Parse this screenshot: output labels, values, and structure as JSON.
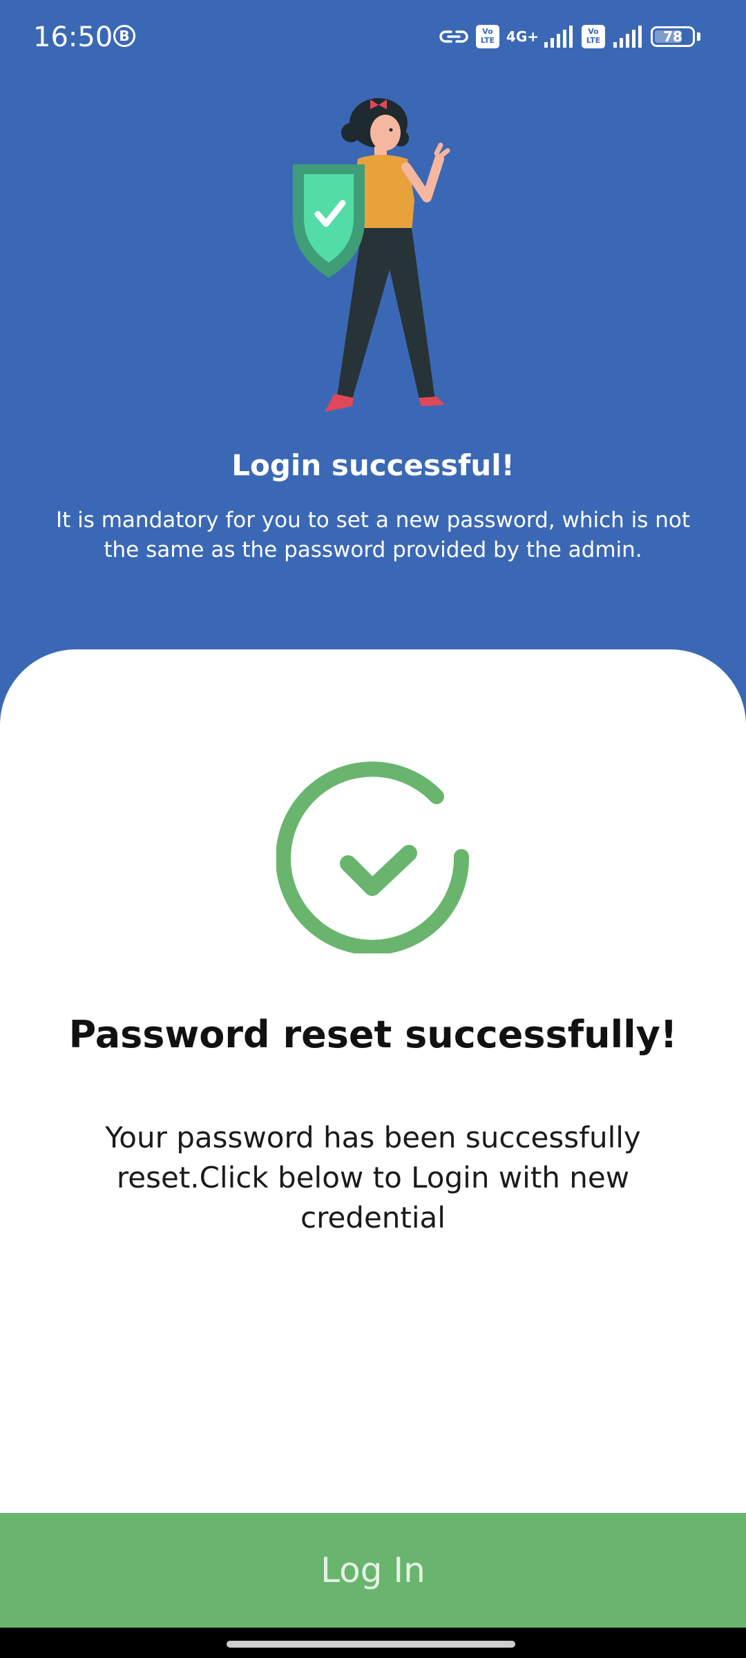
{
  "status_bar": {
    "time": "16:50",
    "b_badge": "B",
    "volte_label": "Vo LTE",
    "network_type": "4G+",
    "battery_level": "78",
    "battery_fraction": 0.78
  },
  "header": {
    "title": "Login successful!",
    "subtitle": "It is mandatory for you to set a new password, which is not the same as the password provided by the admin."
  },
  "card": {
    "title": "Password reset successfully!",
    "message": "Your password has been successfully reset.Click below to Login with new credential"
  },
  "login_button": {
    "label": "Log In"
  },
  "colors": {
    "header_background": "#3B68B5",
    "success_green": "#69B56E",
    "button_text": "#E6F2E6"
  },
  "icons": {
    "illustration": "woman-with-shield-illustration",
    "success": "check-circle-icon"
  }
}
